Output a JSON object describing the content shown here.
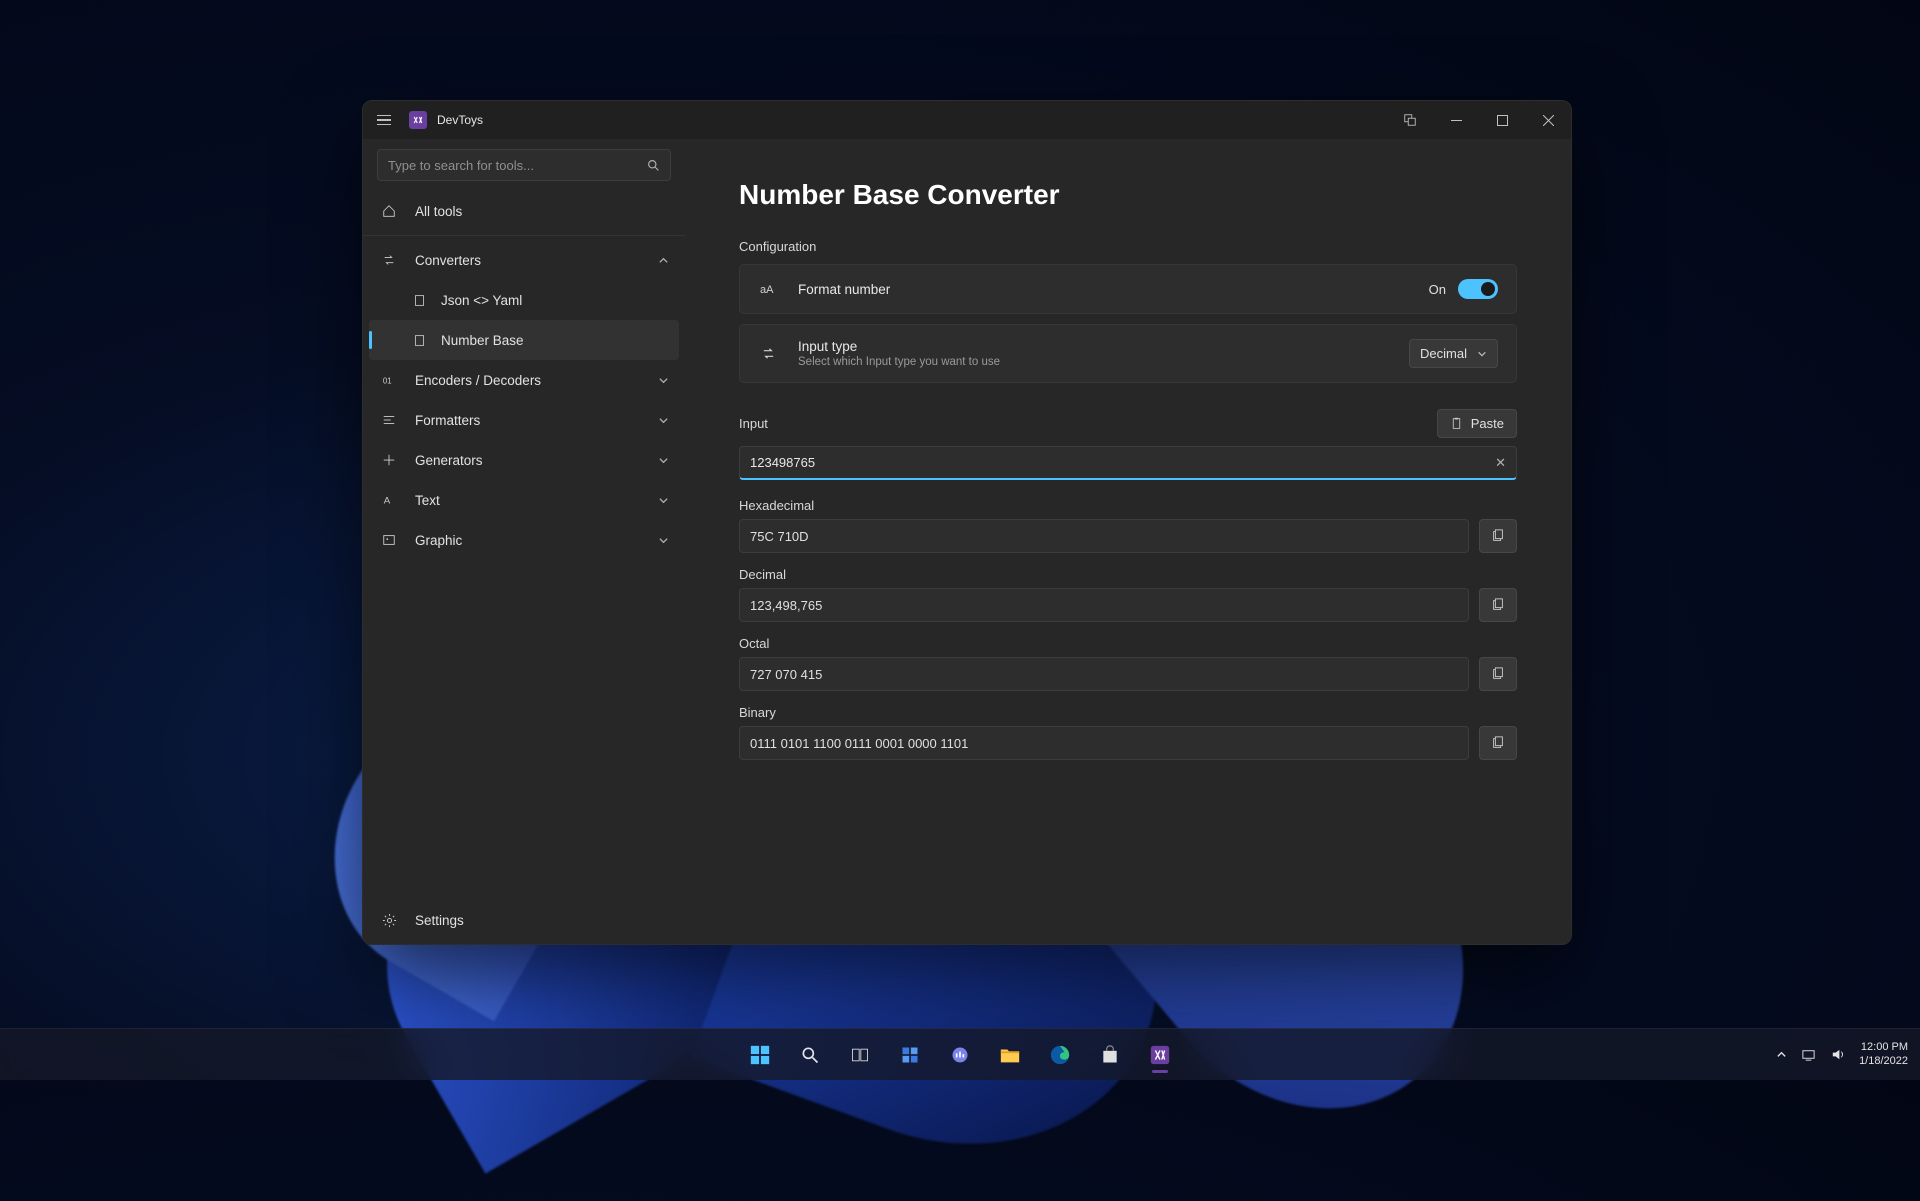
{
  "app": {
    "title": "DevToys"
  },
  "search": {
    "placeholder": "Type to search for tools..."
  },
  "sidebar": {
    "allTools": "All tools",
    "groups": {
      "converters": "Converters",
      "encoders": "Encoders / Decoders",
      "formatters": "Formatters",
      "generators": "Generators",
      "text": "Text",
      "graphic": "Graphic"
    },
    "items": {
      "jsonYaml": "Json <> Yaml",
      "numberBase": "Number Base"
    },
    "settings": "Settings"
  },
  "page": {
    "title": "Number Base Converter",
    "configuration": "Configuration",
    "format": {
      "label": "Format number",
      "state": "On"
    },
    "inputType": {
      "label": "Input type",
      "sub": "Select which Input type you want to use",
      "value": "Decimal"
    },
    "input": {
      "label": "Input",
      "paste": "Paste",
      "value": "123498765"
    },
    "outputs": {
      "hex": {
        "label": "Hexadecimal",
        "value": "75C 710D"
      },
      "dec": {
        "label": "Decimal",
        "value": "123,498,765"
      },
      "oct": {
        "label": "Octal",
        "value": "727 070 415"
      },
      "bin": {
        "label": "Binary",
        "value": "0111 0101 1100 0111 0001 0000 1101"
      }
    }
  },
  "tray": {
    "time": "12:00 PM",
    "date": "1/18/2022"
  },
  "colors": {
    "accent": "#4cc2ff",
    "appIcon": "#6b3fa0"
  }
}
